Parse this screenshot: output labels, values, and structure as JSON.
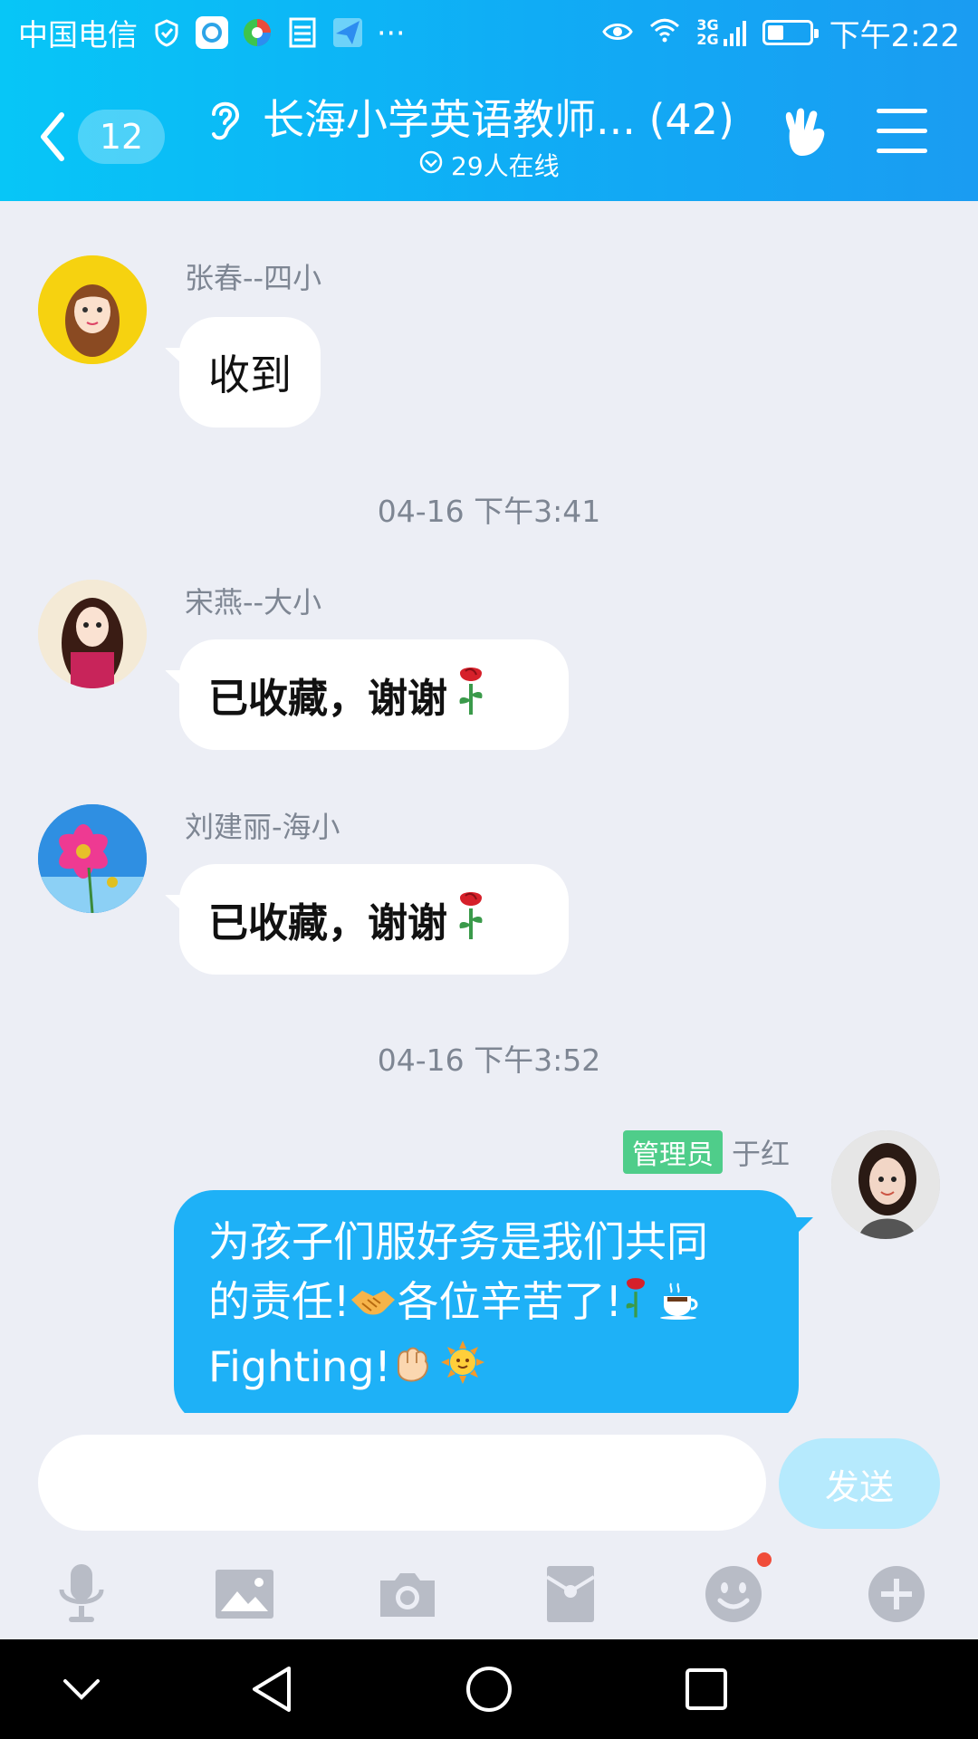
{
  "status_bar": {
    "carrier": "中国电信",
    "more": "···",
    "net_label_top": "3G",
    "net_label_bottom": "2G",
    "time": "下午2:22"
  },
  "header": {
    "unread_count": "12",
    "group_title": "长海小学英语教师... (42)",
    "online_status": "29人在线"
  },
  "messages": [
    {
      "sender": "张春--四小",
      "text": "收到"
    },
    {
      "time": "04-16 下午3:41"
    },
    {
      "sender": "宋燕--大小",
      "text": "已收藏，谢谢"
    },
    {
      "sender": "刘建丽-海小",
      "text": "已收藏，谢谢"
    },
    {
      "time": "04-16 下午3:52"
    },
    {
      "sender": "于红",
      "badge": "管理员",
      "line1": "为孩子们服好务是我们共同",
      "line2": "的责任!",
      "line2b": "各位辛苦了!",
      "line3": "Fighting!"
    }
  ],
  "input": {
    "placeholder": "",
    "send_label": "发送"
  },
  "icons": [
    "back-chevron-icon",
    "ear-icon",
    "hand-sign-icon",
    "menu-icon",
    "microphone-icon",
    "image-icon",
    "camera-icon",
    "red-packet-icon",
    "emoji-icon",
    "plus-icon"
  ],
  "colors": {
    "header": "#10acf5",
    "my_bubble": "#1eb1f7",
    "admin_badge": "#4fcd8a",
    "send_button": "#b6eafd",
    "background": "#eceef5"
  }
}
